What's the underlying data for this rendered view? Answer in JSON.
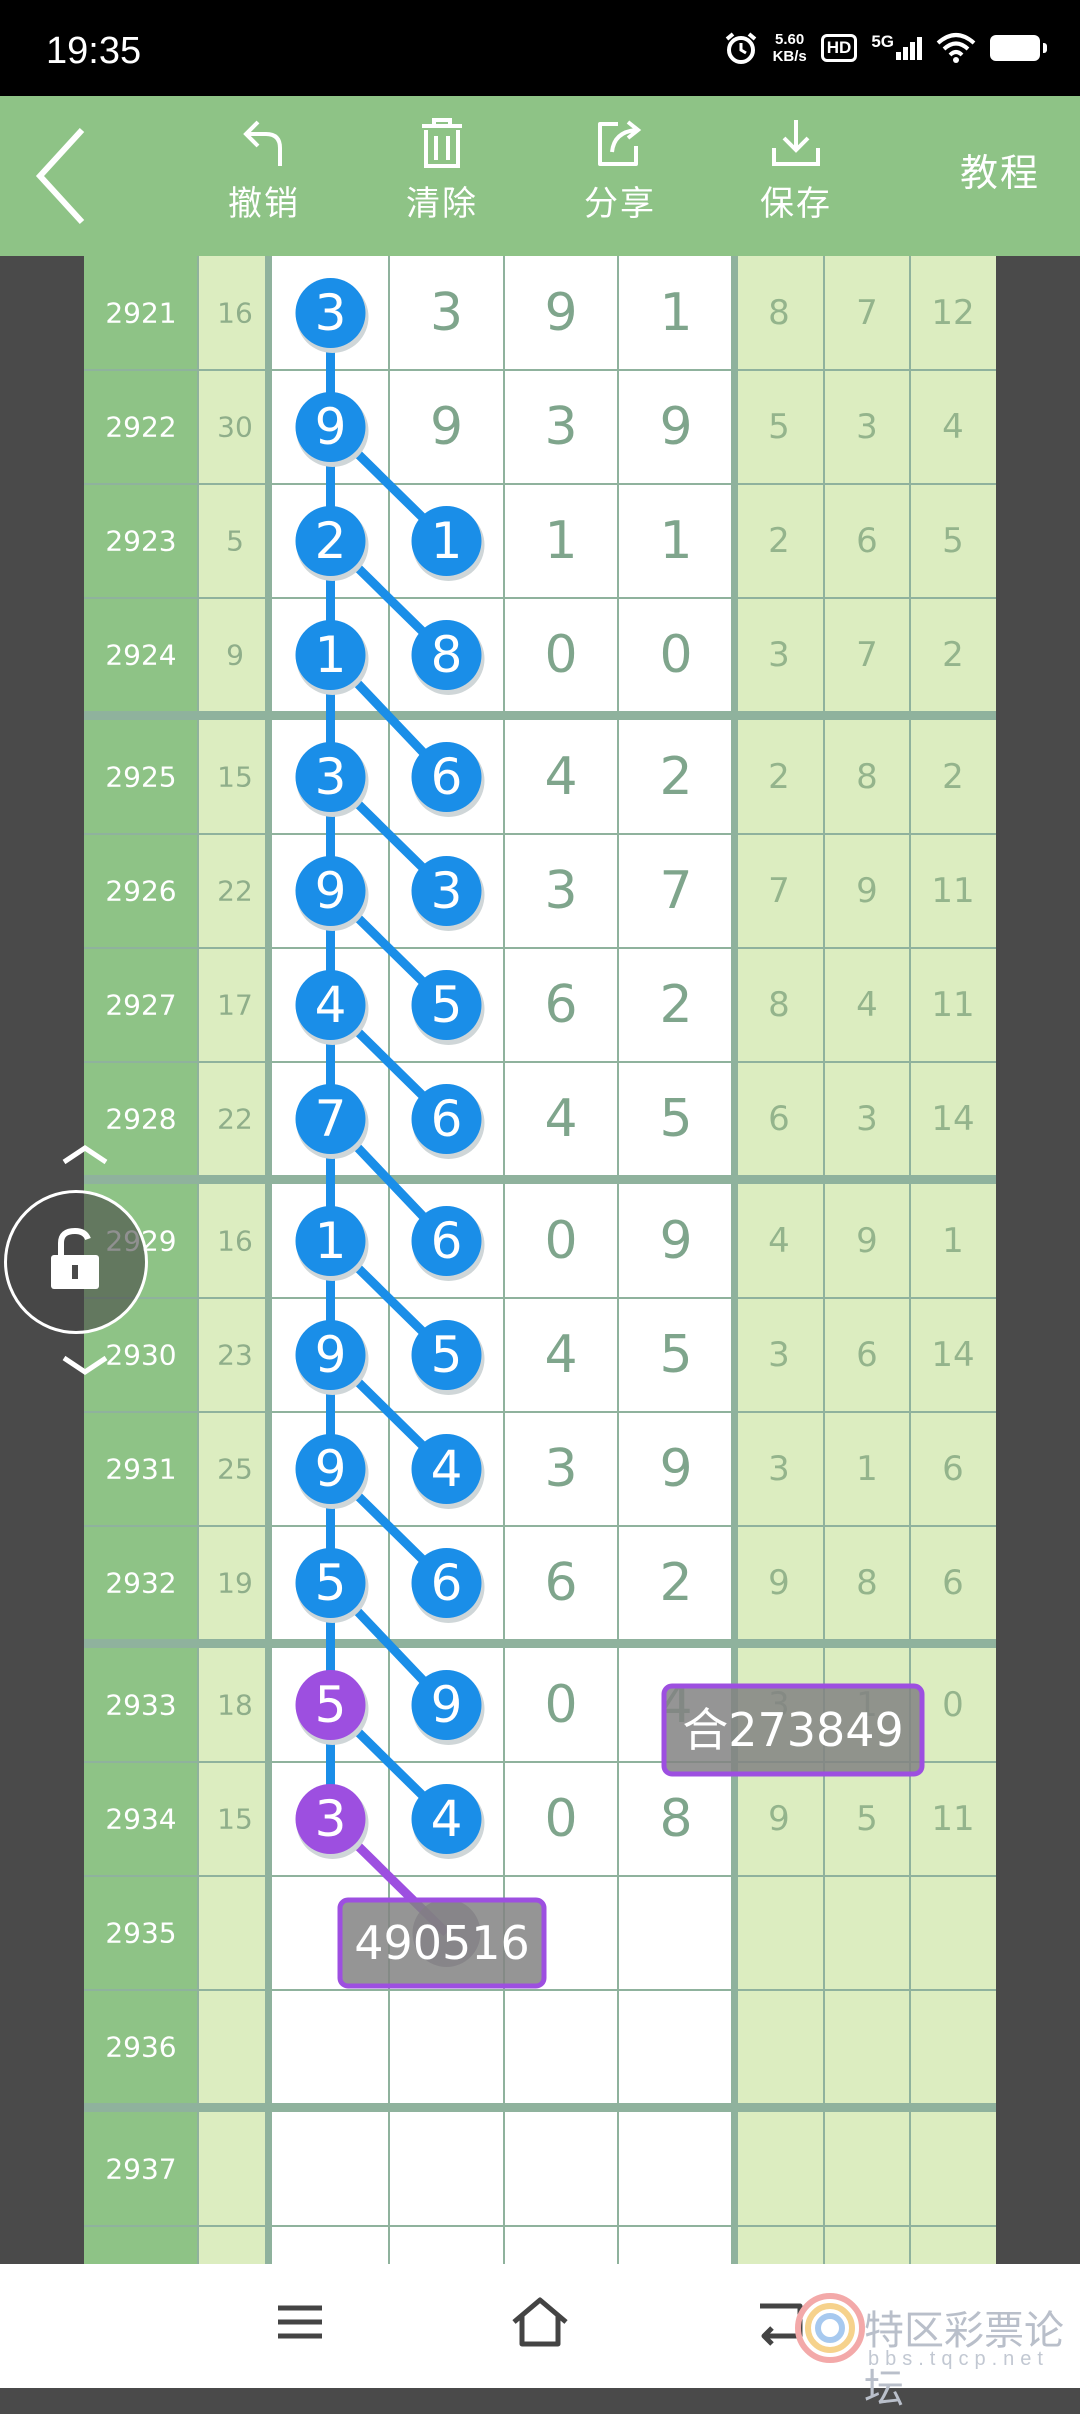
{
  "status_bar": {
    "time": "19:35",
    "speed_value": "5.60",
    "speed_unit": "KB/s",
    "hd": "HD",
    "network": "5G"
  },
  "toolbar": {
    "undo_label": "撤销",
    "clear_label": "清除",
    "share_label": "分享",
    "save_label": "保存",
    "tutorial_label": "教程"
  },
  "table": {
    "rows": [
      {
        "period": "2921",
        "sum": "16",
        "digits": [
          "3",
          "3",
          "9",
          "1"
        ],
        "tail": [
          "8",
          "7",
          "12"
        ]
      },
      {
        "period": "2922",
        "sum": "30",
        "digits": [
          "9",
          "9",
          "3",
          "9"
        ],
        "tail": [
          "5",
          "3",
          "4"
        ]
      },
      {
        "period": "2923",
        "sum": "5",
        "digits": [
          "2",
          "1",
          "1",
          "1"
        ],
        "tail": [
          "2",
          "6",
          "5"
        ]
      },
      {
        "period": "2924",
        "sum": "9",
        "digits": [
          "1",
          "8",
          "0",
          "0"
        ],
        "tail": [
          "3",
          "7",
          "2"
        ]
      },
      {
        "period": "2925",
        "sum": "15",
        "digits": [
          "3",
          "6",
          "4",
          "2"
        ],
        "tail": [
          "2",
          "8",
          "2"
        ]
      },
      {
        "period": "2926",
        "sum": "22",
        "digits": [
          "9",
          "3",
          "3",
          "7"
        ],
        "tail": [
          "7",
          "9",
          "11"
        ]
      },
      {
        "period": "2927",
        "sum": "17",
        "digits": [
          "4",
          "5",
          "6",
          "2"
        ],
        "tail": [
          "8",
          "4",
          "11"
        ]
      },
      {
        "period": "2928",
        "sum": "22",
        "digits": [
          "7",
          "6",
          "4",
          "5"
        ],
        "tail": [
          "6",
          "3",
          "14"
        ]
      },
      {
        "period": "2929",
        "sum": "16",
        "digits": [
          "1",
          "6",
          "0",
          "9"
        ],
        "tail": [
          "4",
          "9",
          "1"
        ]
      },
      {
        "period": "2930",
        "sum": "23",
        "digits": [
          "9",
          "5",
          "4",
          "5"
        ],
        "tail": [
          "3",
          "6",
          "14"
        ]
      },
      {
        "period": "2931",
        "sum": "25",
        "digits": [
          "9",
          "4",
          "3",
          "9"
        ],
        "tail": [
          "3",
          "1",
          "6"
        ]
      },
      {
        "period": "2932",
        "sum": "19",
        "digits": [
          "5",
          "6",
          "6",
          "2"
        ],
        "tail": [
          "9",
          "8",
          "6"
        ]
      },
      {
        "period": "2933",
        "sum": "18",
        "digits": [
          "5",
          "9",
          "0",
          "4"
        ],
        "tail": [
          "3",
          "1",
          "0"
        ]
      },
      {
        "period": "2934",
        "sum": "15",
        "digits": [
          "3",
          "4",
          "0",
          "8"
        ],
        "tail": [
          "9",
          "5",
          "11"
        ]
      },
      {
        "period": "2935",
        "sum": "",
        "digits": [
          "",
          "",
          "",
          ""
        ],
        "tail": [
          "",
          "",
          ""
        ]
      },
      {
        "period": "2936",
        "sum": "",
        "digits": [
          "",
          "",
          "",
          ""
        ],
        "tail": [
          "",
          "",
          ""
        ]
      },
      {
        "period": "2937",
        "sum": "",
        "digits": [
          "",
          "",
          "",
          ""
        ],
        "tail": [
          "",
          "",
          ""
        ]
      }
    ],
    "highlight_col1": [
      0,
      1,
      2,
      3,
      4,
      5,
      6,
      7,
      8,
      9,
      10,
      11
    ],
    "purple_col1": [
      12,
      13
    ],
    "highlight_col2": [
      2,
      3,
      4,
      5,
      6,
      7,
      8,
      9,
      10,
      11,
      12,
      13
    ]
  },
  "annotations": [
    {
      "text": "合273849"
    },
    {
      "text": "490516"
    }
  ],
  "colors": {
    "blue_ball": "#1a8ee8",
    "purple_ball": "#9d4fe0",
    "period_col": "#8ec386",
    "light_col": "#dcedc0",
    "grid": "#8fb29d",
    "digit_text": "#7fa58c"
  }
}
